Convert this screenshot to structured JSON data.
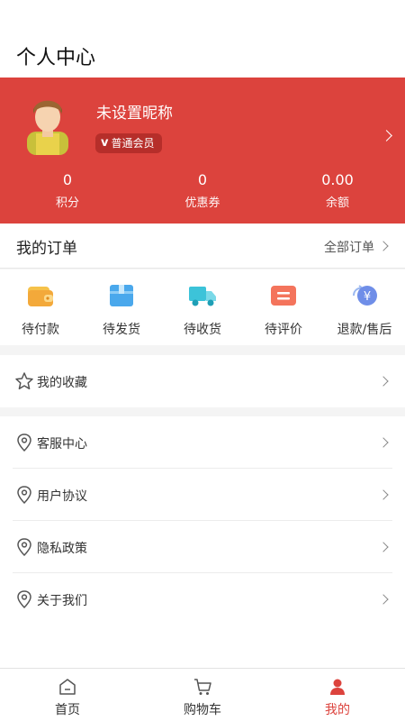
{
  "header": {
    "title": "个人中心"
  },
  "profile": {
    "nickname": "未设置昵称",
    "member_level": "普通会员",
    "member_icon": "v-badge-icon"
  },
  "stats": [
    {
      "value": "0",
      "label": "积分"
    },
    {
      "value": "0",
      "label": "优惠券"
    },
    {
      "value": "0.00",
      "label": "余额"
    }
  ],
  "orders": {
    "title": "我的订单",
    "all_label": "全部订单",
    "items": [
      {
        "label": "待付款",
        "icon": "wallet-icon"
      },
      {
        "label": "待发货",
        "icon": "box-icon"
      },
      {
        "label": "待收货",
        "icon": "truck-icon"
      },
      {
        "label": "待评价",
        "icon": "comment-icon"
      },
      {
        "label": "退款/售后",
        "icon": "refund-icon"
      }
    ]
  },
  "menu": {
    "favorites": {
      "label": "我的收藏",
      "icon": "star-icon"
    },
    "items": [
      {
        "label": "客服中心",
        "icon": "location-pin-icon"
      },
      {
        "label": "用户协议",
        "icon": "location-pin-icon"
      },
      {
        "label": "隐私政策",
        "icon": "location-pin-icon"
      },
      {
        "label": "关于我们",
        "icon": "location-pin-icon"
      }
    ]
  },
  "tabbar": {
    "items": [
      {
        "label": "首页",
        "icon": "home-icon"
      },
      {
        "label": "购物车",
        "icon": "cart-icon"
      },
      {
        "label": "我的",
        "icon": "user-icon",
        "active": true
      }
    ]
  },
  "colors": {
    "primary": "#dc433d",
    "badge_bg": "#b62e2a",
    "background": "#f4f4f4"
  }
}
